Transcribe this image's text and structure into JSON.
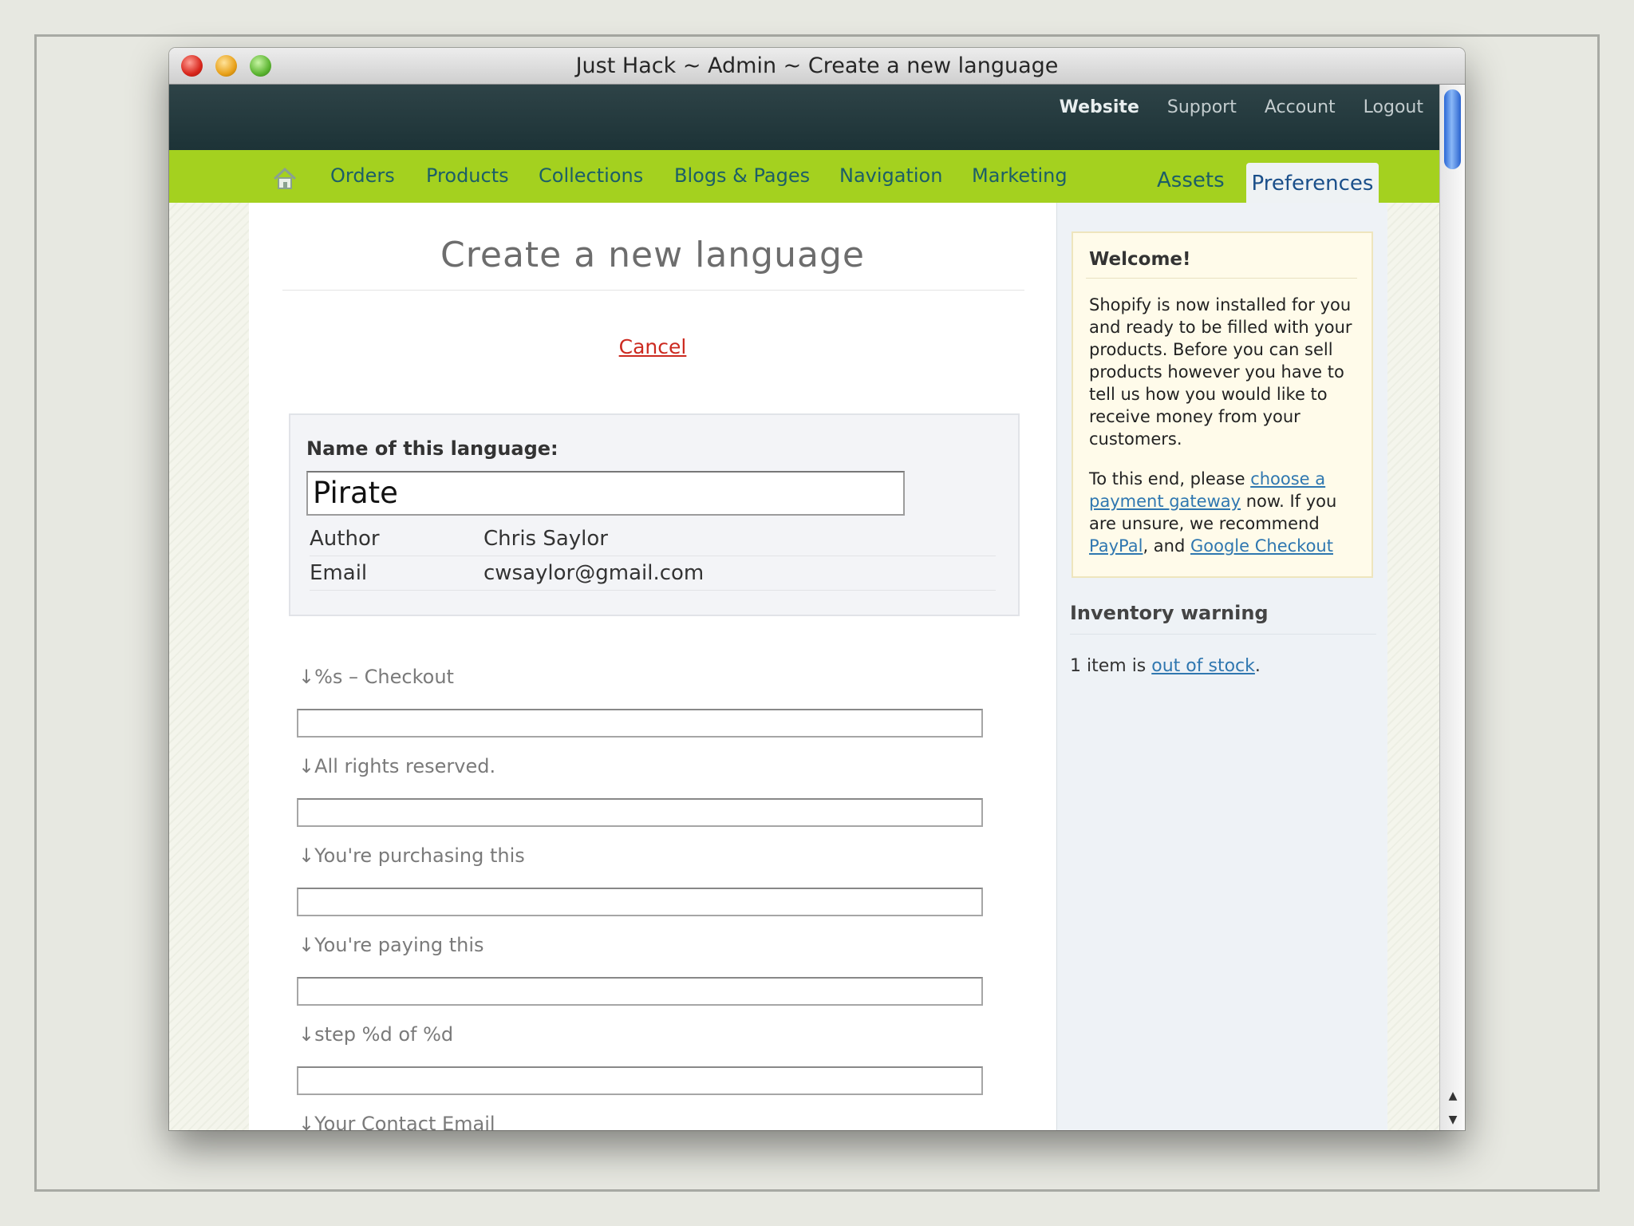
{
  "window": {
    "title": "Just Hack ~ Admin ~ Create a new language"
  },
  "toplinks": [
    "Website",
    "Support",
    "Account",
    "Logout"
  ],
  "nav": {
    "home_icon": "home-icon",
    "items": [
      "Orders",
      "Products",
      "Collections",
      "Blogs & Pages",
      "Navigation",
      "Marketing",
      "Assets"
    ],
    "active": "Preferences"
  },
  "main": {
    "title": "Create a new language",
    "cancel": "Cancel",
    "name_label": "Name of this language:",
    "name_value": "Pirate",
    "info": [
      {
        "key": "Author",
        "value": "Chris Saylor"
      },
      {
        "key": "Email",
        "value": "cwsaylor@gmail.com"
      }
    ],
    "fields": [
      {
        "label": "↓%s – Checkout",
        "value": ""
      },
      {
        "label": "↓All rights reserved.",
        "value": ""
      },
      {
        "label": "↓You're purchasing this",
        "value": ""
      },
      {
        "label": "↓You're paying this",
        "value": ""
      },
      {
        "label": "↓step %d of %d",
        "value": ""
      },
      {
        "label": "↓Your Contact Email",
        "value": ""
      }
    ]
  },
  "sidebar": {
    "welcome": {
      "title": "Welcome!",
      "p1": "Shopify is now installed for you and ready to be filled with your products. Before you can sell products however you have to tell us how you would like to receive money from your customers.",
      "p2_pre": "To this end, please ",
      "p2_link": "choose a payment gateway",
      "p2_mid": " now. If you are unsure, we recommend ",
      "paypal": "PayPal",
      "p2_and": ", and ",
      "google": "Google Checkout"
    },
    "inventory": {
      "title": "Inventory warning",
      "pre": "1 item is ",
      "link": "out of stock",
      "post": "."
    }
  },
  "colors": {
    "navbar": "#a4d11f",
    "topbar": "#1e3438",
    "nav_text": "#1c5e67",
    "cancel": "#cc2a20",
    "link": "#2f77b0"
  }
}
